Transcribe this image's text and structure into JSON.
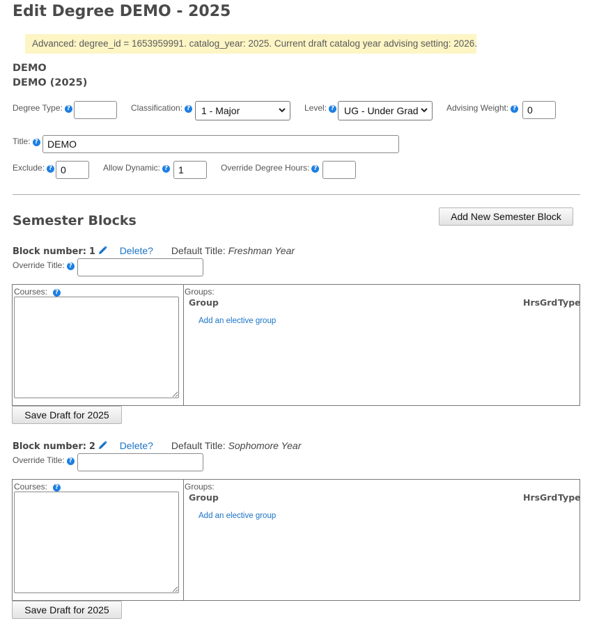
{
  "page": {
    "title": "Edit Degree DEMO - 2025",
    "notice": "Advanced: degree_id = 1653959991. catalog_year: 2025. Current draft catalog year advising setting: 2026.",
    "subtitle_line1": "DEMO",
    "subtitle_line2": "DEMO (2025)"
  },
  "form": {
    "degree_type": {
      "label": "Degree Type:",
      "value": ""
    },
    "classification": {
      "label": "Classification:",
      "value": "1 - Major"
    },
    "level": {
      "label": "Level:",
      "value": "UG - Under Grad"
    },
    "advising_weight": {
      "label": "Advising Weight:",
      "value": "0"
    },
    "title": {
      "label": "Title:",
      "value": "DEMO"
    },
    "exclude": {
      "label": "Exclude:",
      "value": "0"
    },
    "allow_dynamic": {
      "label": "Allow Dynamic:",
      "value": "1"
    },
    "override_hours": {
      "label": "Override Degree Hours:",
      "value": ""
    }
  },
  "help_icon": "?",
  "semester": {
    "heading": "Semester Blocks",
    "add_button": "Add New Semester Block",
    "blocks": [
      {
        "label": "Block number:",
        "number": "1",
        "delete": "Delete?",
        "default_title_label": "Default Title:",
        "default_title": "Freshman Year",
        "override_label": "Override Title:",
        "override_value": "",
        "courses_label": "Courses:",
        "groups_label": "Groups:",
        "col_group": "Group",
        "col_hrs": "Hrs",
        "col_grd": "Grd",
        "col_type": "Type",
        "add_group": "Add an elective group",
        "save_button": "Save Draft for 2025"
      },
      {
        "label": "Block number:",
        "number": "2",
        "delete": "Delete?",
        "default_title_label": "Default Title:",
        "default_title": "Sophomore Year",
        "override_label": "Override Title:",
        "override_value": "",
        "courses_label": "Courses:",
        "groups_label": "Groups:",
        "col_group": "Group",
        "col_hrs": "Hrs",
        "col_grd": "Grd",
        "col_type": "Type",
        "add_group": "Add an elective group",
        "save_button": "Save Draft for 2025"
      }
    ]
  },
  "icons": {
    "help": "help-icon",
    "edit": "pencil-icon",
    "dropdown": "chevron-down-icon"
  },
  "colors": {
    "link": "#1a73c6",
    "help": "#1d7fe3",
    "notice_bg": "#fdf5c4"
  }
}
